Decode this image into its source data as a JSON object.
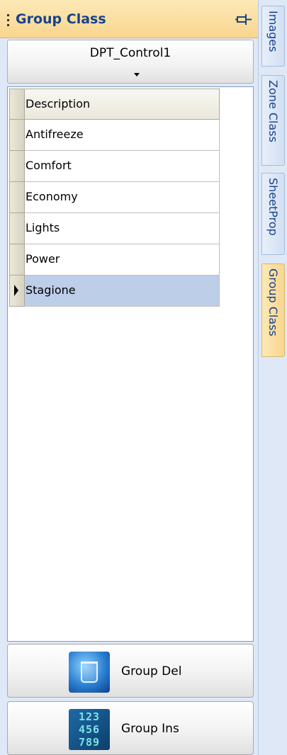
{
  "panel": {
    "title": "Group Class",
    "dropdown_value": "DPT_Control1"
  },
  "grid": {
    "column_header": "Description",
    "rows": [
      "Antifreeze",
      "Comfort",
      "Economy",
      "Lights",
      "Power",
      "Stagione"
    ],
    "selected_row": "Stagione"
  },
  "buttons": {
    "delete_label": "Group Del",
    "insert_label": "Group Ins",
    "numpad_digits": [
      "123",
      "456",
      "789"
    ]
  },
  "tabs": [
    "Images",
    "Zone Class",
    "SheetProp",
    "Group Class"
  ],
  "active_tab": "Group Class",
  "colors": {
    "header_gold": "#f9d58f",
    "title_blue": "#15428b",
    "selection": "#bccee8",
    "background": "#dfe8f6"
  }
}
